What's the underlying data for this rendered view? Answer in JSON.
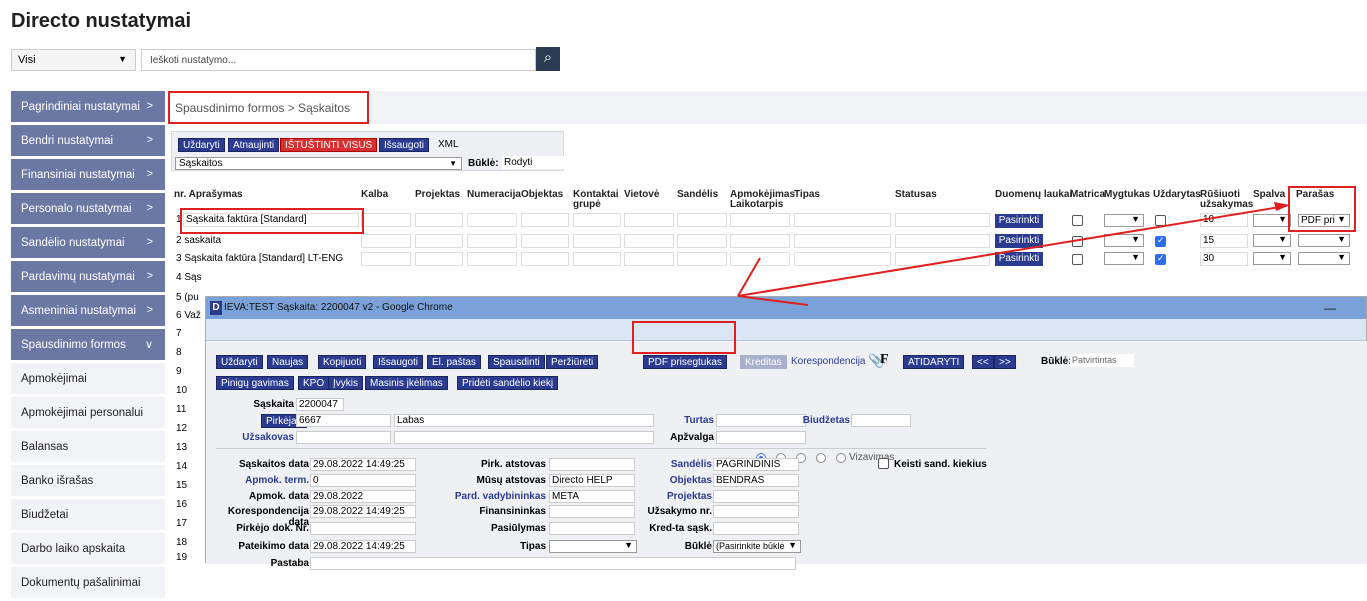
{
  "page": {
    "title": "Directo nustatymai"
  },
  "filter": {
    "selected": "Visi",
    "search_placeholder": "Ieškoti nustatymo..."
  },
  "sidebar": {
    "items": [
      {
        "label": "Pagrindiniai nustatymai"
      },
      {
        "label": "Bendri nustatymai"
      },
      {
        "label": "Finansiniai nustatymai"
      },
      {
        "label": "Personalo nustatymai"
      },
      {
        "label": "Sandėlio nustatymai"
      },
      {
        "label": "Pardavimų nustatymai"
      },
      {
        "label": "Asmeniniai nustatymai"
      },
      {
        "label": "Spausdinimo formos"
      }
    ],
    "subitems": [
      {
        "label": "Apmokėjimai"
      },
      {
        "label": "Apmokėjimai personalui"
      },
      {
        "label": "Balansas"
      },
      {
        "label": "Banko išrašas"
      },
      {
        "label": "Biudžetai"
      },
      {
        "label": "Darbo laiko apskaita"
      },
      {
        "label": "Dokumentų pašalinimai"
      }
    ]
  },
  "breadcrumb": "Spausdinimo formos > Sąskaitos",
  "toolbar": {
    "close": "Uždaryti",
    "refresh": "Atnaujinti",
    "delete_all": "IŠTUŠTINTI VISUS",
    "save": "Išsaugoti",
    "xml": "XML",
    "doc_select": "Sąskaitos",
    "state_label": "Būklė:",
    "state_value": "Rodyti"
  },
  "table": {
    "headers": {
      "nr": "nr.",
      "desc": "Aprašymas",
      "lang": "Kalba",
      "project": "Projektas",
      "numbering": "Numeracija",
      "object": "Objektas",
      "contact_group": "Kontaktai grupė",
      "place": "Vietovė",
      "warehouse": "Sandėlis",
      "pay_term": "Apmokėjimas Laikotarpis",
      "type": "Tipas",
      "status": "Statusas",
      "data_fields": "Duomenų laukai",
      "matrix": "Matrica",
      "buttons": "Mygtukas",
      "closed": "Uždarytas",
      "sort_order": "Rūšiuoti užsakymas",
      "color": "Spalva",
      "signature": "Parašas"
    },
    "rows": [
      {
        "nr": "1",
        "desc": "Sąskaita faktūra [Standard]",
        "sort": "10",
        "sig": "PDF pri"
      },
      {
        "nr": "2",
        "desc": "saskaita",
        "sort": "15"
      },
      {
        "nr": "3",
        "desc": "Sąskaita faktūra [Standard] LT-ENG",
        "sort": "30"
      },
      {
        "nr": "4",
        "desc": "Sąs"
      },
      {
        "nr": "5",
        "desc": "(pu"
      },
      {
        "nr": "6",
        "desc": "Važ"
      }
    ],
    "more_rows": [
      "7",
      "8",
      "9",
      "10",
      "11",
      "12",
      "13",
      "14",
      "15",
      "16",
      "17",
      "18",
      "19"
    ],
    "choose": "Pasirinkti"
  },
  "popup": {
    "window_title": "IEVA:TEST Sąskaita: 2200047 v2 - Google Chrome",
    "logo": "D",
    "buttons1": [
      "Uždaryti",
      "Naujas",
      "Kopijuoti",
      "Išsaugoti",
      "El. paštas",
      "Spausdinti",
      "Peržiūrėti",
      "PDF prisegtukas",
      "Kreditas"
    ],
    "korespondencija": "Korespondencija",
    "f": "F",
    "open": "ATIDARYTI",
    "prev": "<<",
    "next": ">>",
    "state_label": "Būklė:",
    "state_value": "Patvirtintas",
    "buttons2": [
      "Pinigų gavimas",
      "KPO",
      "Įvykis",
      "Masinis įkėlimas",
      "Pridėti sandėlio kiekį"
    ],
    "invoice_label": "Sąskaita",
    "invoice_no": "2200047",
    "buyer_btn": "Pirkėjas",
    "buyer_code": "6667",
    "buyer_name": "Labas",
    "turtas": "Turtas",
    "budget": "Biudžetas",
    "orderer": "Užsakovas",
    "overview": "Apžvalga",
    "vizavimas": "Vizavimas",
    "f_date_l": "Sąskaitos data",
    "f_date": "29.08.2022 14:49:25",
    "f_term_l": "Apmok. term.",
    "f_term": "0",
    "f_paydate_l": "Apmok. data",
    "f_paydate": "29.08.2022",
    "f_corr_l": "Korespondencija data",
    "f_corr": "29.08.2022 14:49:25",
    "f_buyerdoc_l": "Pirkėjo dok. Nr.",
    "f_subm_l": "Pateikimo data",
    "f_subm": "29.08.2022 14:49:25",
    "f_note_l": "Pastaba",
    "m_buyrep_l": "Pirk. atstovas",
    "m_ourrep_l": "Mūsų atstovas",
    "m_ourrep": "Directo HELP",
    "m_salesmgr_l": "Pard. vadybininkas",
    "m_salesmgr": "META",
    "m_fin_l": "Finansininkas",
    "m_offer_l": "Pasiūlymas",
    "m_type_l": "Tipas",
    "r_wh_l": "Sandėlis",
    "r_wh": "PAGRINDINIS",
    "r_obj_l": "Objektas",
    "r_obj": "BENDRAS",
    "r_proj_l": "Projektas",
    "r_order_l": "Užsakymo nr.",
    "r_cred_l": "Kred-ta sąsk.",
    "r_state_l": "Būklė",
    "r_state": "(Pasirinkite būklė",
    "keisti": "Keisti sand. kiekius",
    "minimize": "—"
  },
  "colors": {
    "sidebar": "#6b78a4",
    "accent": "#2b3b8f",
    "highlight": "#e02020"
  }
}
